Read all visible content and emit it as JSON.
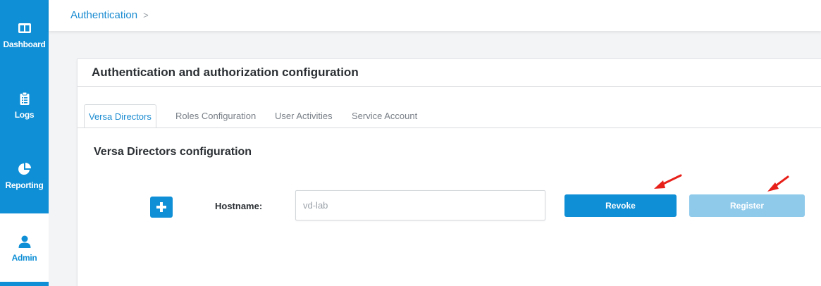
{
  "sidebar": {
    "items": [
      {
        "label": "Dashboard",
        "icon": "dashboard-icon",
        "active": false
      },
      {
        "label": "Logs",
        "icon": "clipboard-icon",
        "active": false
      },
      {
        "label": "Reporting",
        "icon": "pie-chart-icon",
        "active": false
      },
      {
        "label": "Admin",
        "icon": "user-icon",
        "active": true
      }
    ],
    "colors": {
      "background": "#0f8fd6",
      "active_background": "#ffffff"
    }
  },
  "breadcrumb": {
    "current": "Authentication",
    "separator": ">"
  },
  "card": {
    "title": "Authentication and authorization configuration",
    "tabs": [
      {
        "label": "Versa Directors",
        "active": true
      },
      {
        "label": "Roles Configuration",
        "active": false
      },
      {
        "label": "User Activities",
        "active": false
      },
      {
        "label": "Service Account",
        "active": false
      }
    ],
    "section_title": "Versa Directors configuration",
    "form": {
      "add_icon": "plus-icon",
      "hostname_label": "Hostname:",
      "hostname_value": "vd-lab",
      "revoke_label": "Revoke",
      "register_label": "Register",
      "register_disabled": true
    }
  },
  "annotations": {
    "arrow_color": "#e8201a",
    "arrows": [
      "pointing-to-revoke",
      "pointing-to-register"
    ]
  },
  "colors": {
    "accent": "#0f8fd6",
    "link": "#1a8bd1",
    "disabled_button": "#8fcaeb"
  }
}
